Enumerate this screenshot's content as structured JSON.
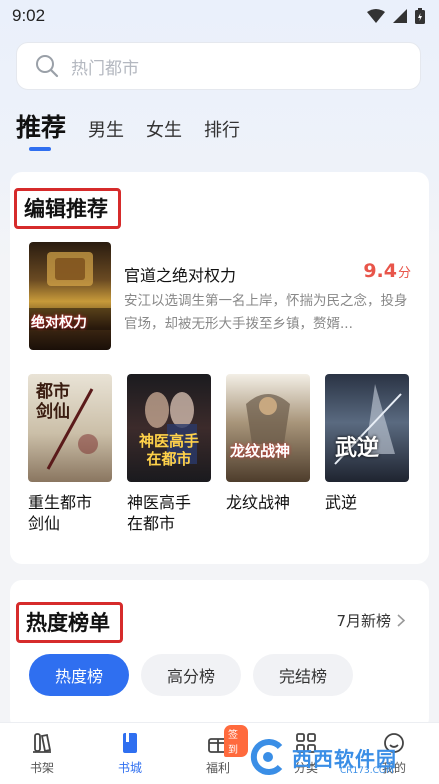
{
  "status": {
    "time": "9:02"
  },
  "search": {
    "placeholder": "热门都市"
  },
  "tabs": [
    {
      "label": "推荐",
      "active": true
    },
    {
      "label": "男生",
      "active": false
    },
    {
      "label": "女生",
      "active": false
    },
    {
      "label": "排行",
      "active": false
    }
  ],
  "editor_picks": {
    "title": "编辑推荐",
    "featured": {
      "title": "官道之绝对权力",
      "score": "9.4",
      "score_unit": "分",
      "description": "安江以选调生第一名上岸，怀揣为民之念，投身官场，却被无形大手拨至乡镇，赘婿...",
      "cover_text": "绝对权力"
    },
    "books": [
      {
        "title": "重生都市剑仙",
        "cover_text": "都市剑仙"
      },
      {
        "title": "神医高手在都市",
        "cover_text": "神医高手在都市"
      },
      {
        "title": "龙纹战神",
        "cover_text": "龙纹战神"
      },
      {
        "title": "武逆",
        "cover_text": "武逆"
      }
    ]
  },
  "hot_list": {
    "title": "热度榜单",
    "link": "7月新榜",
    "chips": [
      {
        "label": "热度榜",
        "active": true
      },
      {
        "label": "高分榜",
        "active": false
      },
      {
        "label": "完结榜",
        "active": false
      }
    ]
  },
  "bottom_nav": [
    {
      "label": "书架",
      "icon": "bookshelf-icon"
    },
    {
      "label": "书城",
      "icon": "book-icon",
      "active": true
    },
    {
      "label": "福利",
      "icon": "gift-icon",
      "badge": "签到"
    },
    {
      "label": "分类",
      "icon": "grid-icon"
    },
    {
      "label": "我的",
      "icon": "user-icon"
    }
  ],
  "watermark": {
    "text": "西西软件园",
    "sub": "CR173.COM"
  },
  "colors": {
    "accent": "#2f6ff0",
    "score": "#e8554a",
    "highlight_border": "#d62b2b"
  }
}
